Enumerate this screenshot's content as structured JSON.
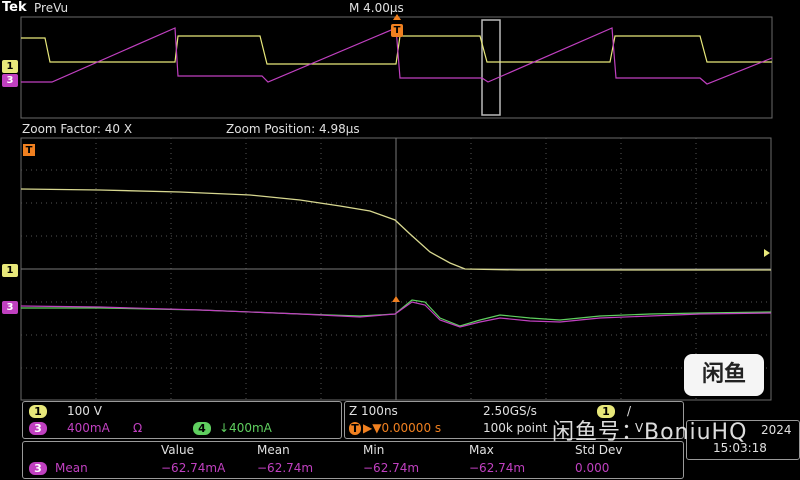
{
  "header": {
    "brand": "Tek",
    "mode": "PreVu",
    "timebase": "M 4.00µs"
  },
  "zoom": {
    "factor": "Zoom Factor: 40 X",
    "position": "Zoom Position: 4.98µs"
  },
  "markers": {
    "trigger": "T",
    "ch1": "1",
    "ch3": "3"
  },
  "channels_panel": {
    "ch1_badge": "1",
    "ch1_scale": "100 V",
    "ch3_badge": "3",
    "ch3_scale": "400mA",
    "ch3_unit_symbol": "Ω",
    "ch4_badge": "4",
    "ch4_scale": "↓400mA"
  },
  "acquisition_panel": {
    "zoom_timebase": "Z 100ns",
    "sample_rate": "2.50GS/s",
    "trigger_label": "T",
    "trigger_position": "▶▼0.00000 s",
    "record_length": "100k point",
    "trigger_channel_badge": "1",
    "trigger_slope": "/",
    "trigger_level_suffix": "V"
  },
  "measurements": {
    "headers": [
      "Value",
      "Mean",
      "Min",
      "Max",
      "Std Dev"
    ],
    "row": {
      "channel": "3",
      "name": "Mean",
      "value": "−62.74mA",
      "mean": "−62.74m",
      "min": "−62.74m",
      "max": "−62.74m",
      "std_dev": "0.000"
    }
  },
  "clock": {
    "date": "2024",
    "time": "15:03:18"
  },
  "watermark": {
    "logo": "闲鱼",
    "text": "闲鱼号：BoniuHQ"
  },
  "colors": {
    "ch1": "#e8e87a",
    "ch3": "#c040c0",
    "ch4": "#5fcf5f",
    "trigger": "#f08020",
    "grid": "#5a5a5a"
  }
}
